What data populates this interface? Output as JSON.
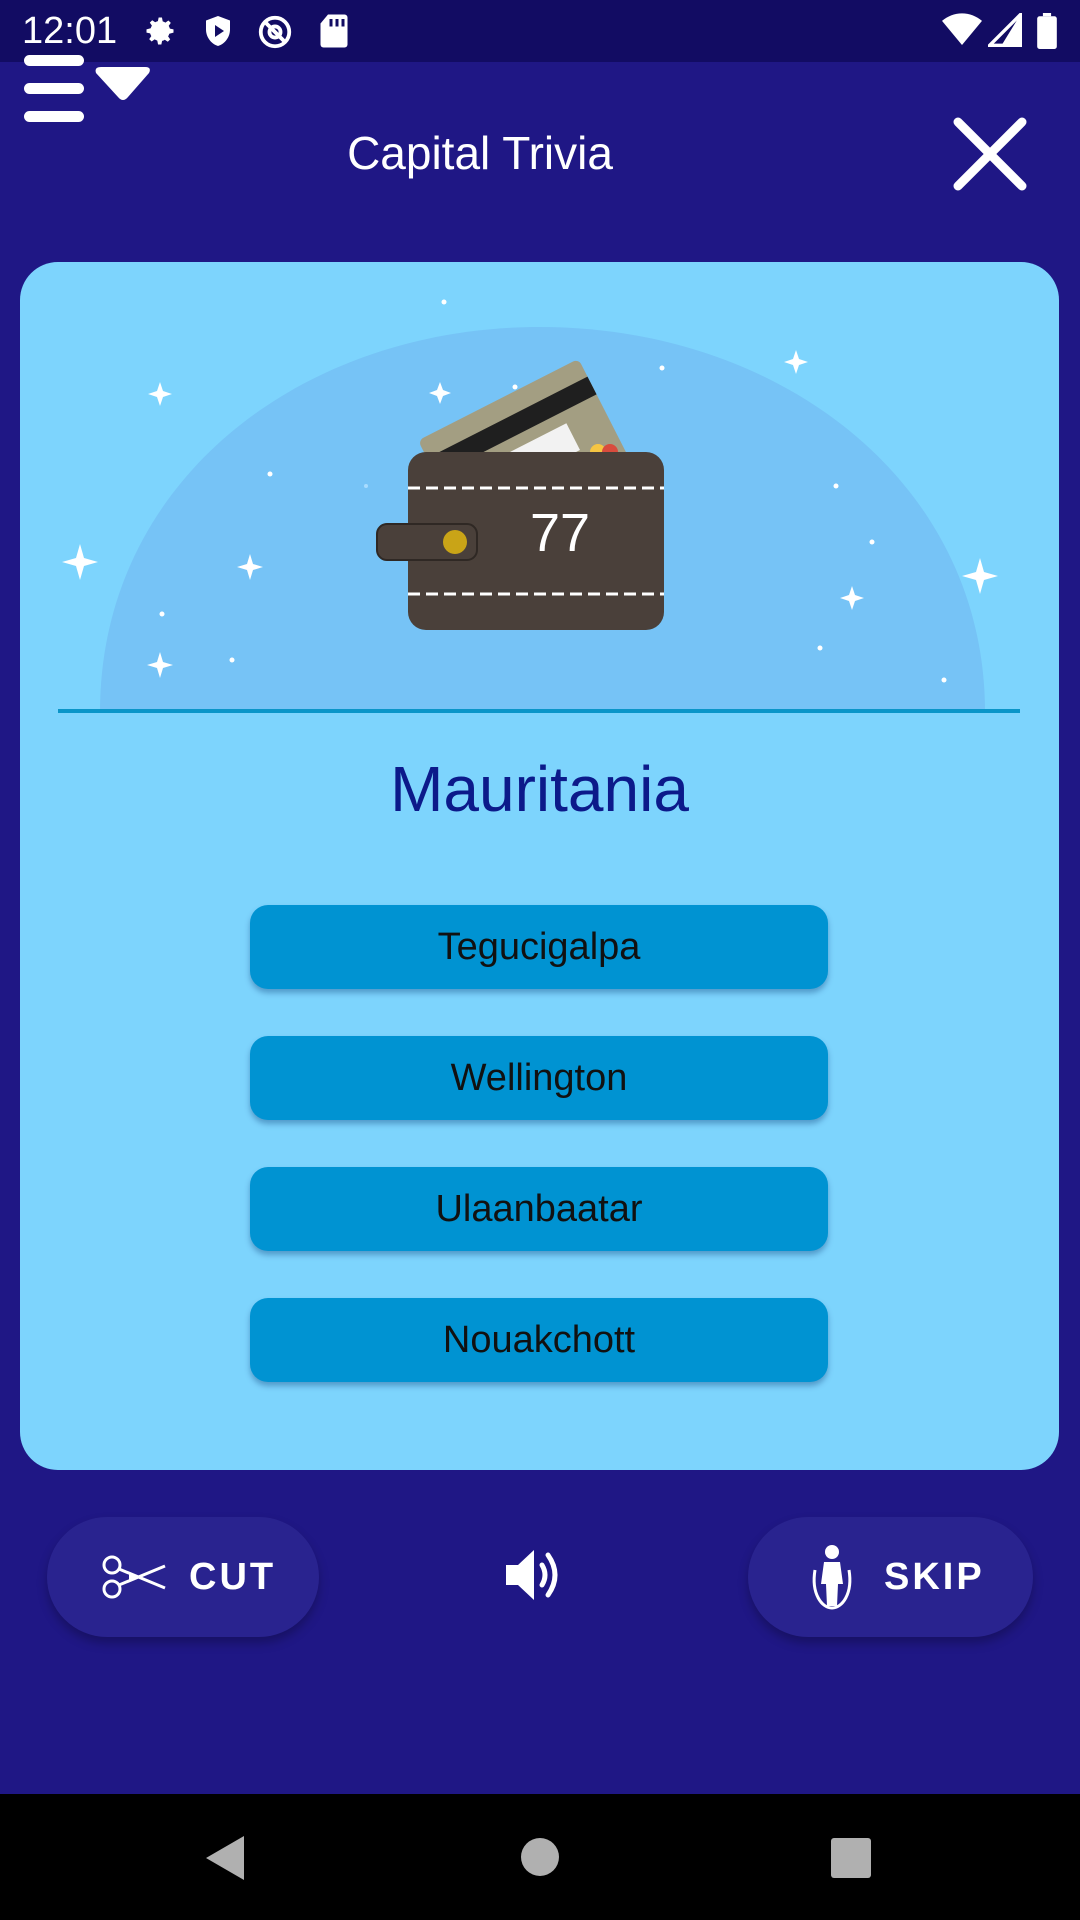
{
  "status_bar": {
    "time": "12:01",
    "icons": [
      "settings-icon",
      "shield-icon",
      "at-icon",
      "sd-card-icon",
      "wifi-icon",
      "signal-icon",
      "battery-icon"
    ]
  },
  "app_bar": {
    "title": "Capital Trivia",
    "menu_icon": "menu-dropdown-icon",
    "close_icon": "close-icon"
  },
  "wallet": {
    "coins": "77"
  },
  "question": {
    "country": "Mauritania"
  },
  "answers": [
    {
      "label": "Tegucigalpa"
    },
    {
      "label": "Wellington"
    },
    {
      "label": "Ulaanbaatar"
    },
    {
      "label": "Nouakchott"
    }
  ],
  "actions": {
    "cut_label": "CUT",
    "skip_label": "SKIP",
    "sound_icon": "volume-icon"
  },
  "colors": {
    "background": "#1f1785",
    "status_bar": "#120c63",
    "card": "#7dd4fd",
    "answer_button": "#0093d2",
    "country_text": "#0c1a8a",
    "pill": "#29238f"
  },
  "nav_bar": {
    "icons": [
      "back-icon",
      "home-icon",
      "recents-icon"
    ]
  }
}
